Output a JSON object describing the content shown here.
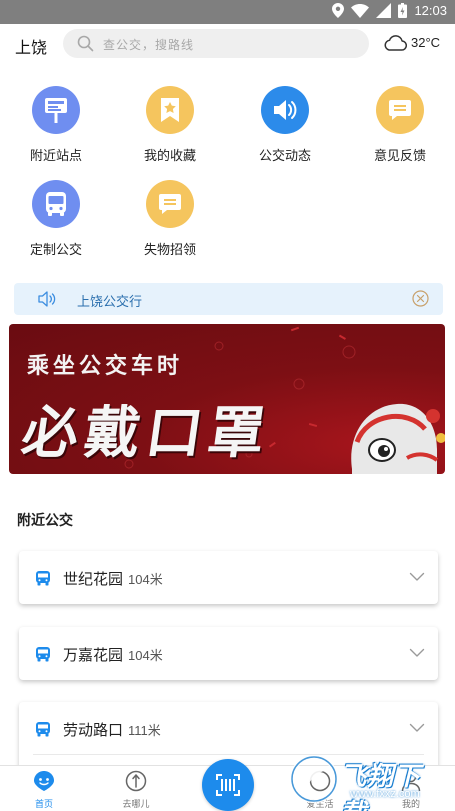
{
  "status_bar": {
    "time": "12:03"
  },
  "header": {
    "city": "上饶",
    "search_placeholder": "查公交，搜路线",
    "temperature": "32°C"
  },
  "grid": [
    {
      "label": "附近站点",
      "icon": "bus-stop-sign-icon",
      "color": "#6f8ef0"
    },
    {
      "label": "我的收藏",
      "icon": "bookmark-star-icon",
      "color": "#f5c55e"
    },
    {
      "label": "公交动态",
      "icon": "speaker-icon",
      "color": "#2c8bea"
    },
    {
      "label": "意见反馈",
      "icon": "message-icon",
      "color": "#f5c55e"
    },
    {
      "label": "定制公交",
      "icon": "bus-icon",
      "color": "#6f8ef0"
    },
    {
      "label": "失物招领",
      "icon": "message-icon",
      "color": "#f5c55e"
    }
  ],
  "notice": {
    "text": "上饶公交行"
  },
  "banner": {
    "line1": "乘坐公交车时",
    "line2": "必戴口罩"
  },
  "nearby": {
    "title": "附近公交",
    "stops": [
      {
        "name": "世纪花园",
        "distance": "104米"
      },
      {
        "name": "万嘉花园",
        "distance": "104米"
      },
      {
        "name": "劳动路口",
        "distance": "111米"
      }
    ]
  },
  "bottom_nav": [
    {
      "label": "首页",
      "icon": "home-face-icon",
      "active": true
    },
    {
      "label": "去哪儿",
      "icon": "compass-icon",
      "active": false
    },
    {
      "label": "",
      "icon": "scan-icon",
      "active": false
    },
    {
      "label": "爱生活",
      "icon": "life-icon",
      "active": false
    },
    {
      "label": "我的",
      "icon": "user-icon",
      "active": false
    }
  ],
  "watermark": {
    "text": "飞翔下载",
    "url": "www.fxxz.com"
  },
  "colors": {
    "accent": "#1d8bec",
    "purple": "#6f8ef0",
    "yellow": "#f5c55e",
    "banner": "#7d0f14"
  }
}
